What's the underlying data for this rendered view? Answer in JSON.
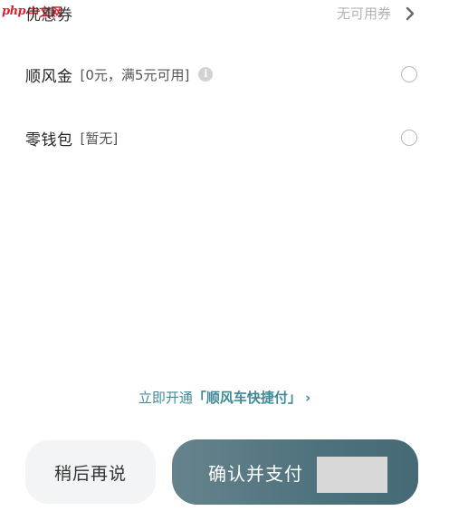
{
  "watermark": {
    "brand": "php",
    "site": "中文网"
  },
  "coupon": {
    "label": "优惠券",
    "status": "无可用券"
  },
  "gold": {
    "label": "顺风金",
    "note": "[0元，满5元可用]"
  },
  "wallet": {
    "label": "零钱包",
    "note": "[暂无]"
  },
  "quickpay": {
    "prefix": "立即开通",
    "open_quote": "「",
    "name": "顺风车快捷付",
    "close_quote": "」",
    "arrow": "›"
  },
  "actions": {
    "later_label": "稍后再说",
    "confirm_label": "确认并支付"
  },
  "colors": {
    "accent": "#3f8a95",
    "confirm_bg": "#4e727d",
    "radio_border": "#b5b9bd"
  }
}
